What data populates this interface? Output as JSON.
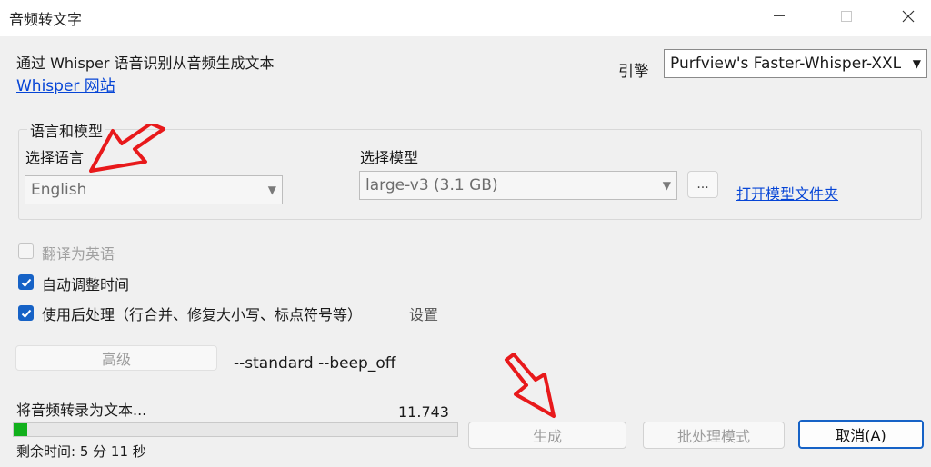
{
  "window": {
    "title": "音频转文字",
    "controls": [
      "minimize-icon",
      "maximize-icon",
      "close-icon"
    ]
  },
  "header": {
    "description": "通过 Whisper 语音识别从音频生成文本",
    "whisper_link": "Whisper 网站",
    "engine_label": "引擎",
    "engine_value": "Purfview's Faster-Whisper-XXL"
  },
  "language_model": {
    "group_title": "语言和模型",
    "language_label": "选择语言",
    "language_value": "English",
    "model_label": "选择模型",
    "model_value": "large-v3 (3.1 GB)",
    "browse_label": "...",
    "open_folder_link": "打开模型文件夹"
  },
  "options": {
    "translate_label": "翻译为英语",
    "translate_checked": false,
    "translate_enabled": false,
    "auto_adjust_label": "自动调整时间",
    "auto_adjust_checked": true,
    "postprocess_label": "使用后处理（行合并、修复大小写、标点符号等）",
    "postprocess_checked": true,
    "settings_label": "设置"
  },
  "advanced": {
    "button_label": "高级",
    "params": "--standard --beep_off"
  },
  "status": {
    "text": "将音频转录为文本...",
    "progress_value": "11.743",
    "progress_fraction": 0.03,
    "time_remaining": "剩余时间: 5 分 11 秒"
  },
  "buttons": {
    "generate": "生成",
    "batch_mode": "批处理模式",
    "cancel": "取消(A)"
  },
  "colors": {
    "accent": "#1662c6",
    "link": "#0645d6",
    "progress": "#12b01c",
    "annotation_arrow": "#e8191b"
  }
}
